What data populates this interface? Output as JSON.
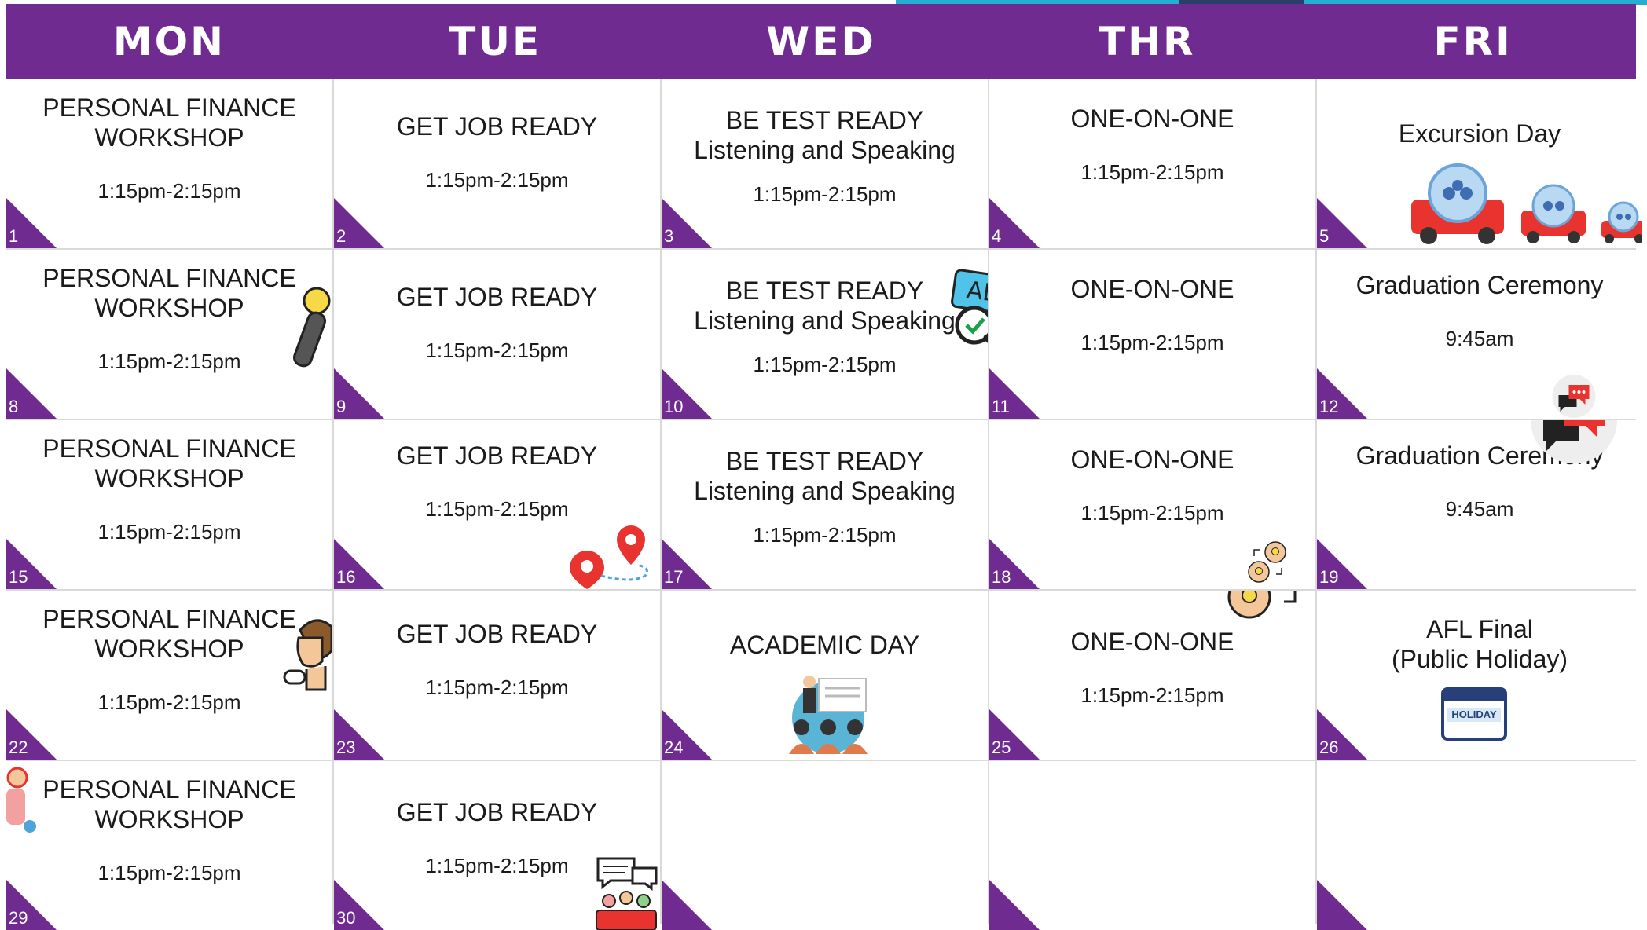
{
  "header": {
    "days": [
      "MON",
      "TUE",
      "WED",
      "THR",
      "FRI"
    ]
  },
  "weeks": [
    {
      "mon": {
        "num": "1",
        "title": "PERSONAL FINANCE WORKSHOP",
        "time": "1:15pm-2:15pm"
      },
      "tue": {
        "num": "2",
        "title": "GET JOB READY",
        "time": "1:15pm-2:15pm"
      },
      "wed": {
        "num": "3",
        "title": "BE TEST READY",
        "subtitle": "Listening and Speaking",
        "time": "1:15pm-2:15pm"
      },
      "thr": {
        "num": "4",
        "title": "ONE-ON-ONE",
        "time": "1:15pm-2:15pm"
      },
      "fri": {
        "num": "5",
        "title": "Excursion Day"
      }
    },
    {
      "mon": {
        "num": "8",
        "title": "PERSONAL FINANCE WORKSHOP",
        "time": "1:15pm-2:15pm"
      },
      "tue": {
        "num": "9",
        "title": "GET JOB READY",
        "time": "1:15pm-2:15pm"
      },
      "wed": {
        "num": "10",
        "title": "BE TEST READY",
        "subtitle": "Listening and Speaking",
        "time": "1:15pm-2:15pm"
      },
      "thr": {
        "num": "11",
        "title": "ONE-ON-ONE",
        "time": "1:15pm-2:15pm"
      },
      "fri": {
        "num": "12",
        "title": "Graduation Ceremony",
        "time": "9:45am"
      }
    },
    {
      "mon": {
        "num": "15",
        "title": "PERSONAL FINANCE WORKSHOP",
        "time": "1:15pm-2:15pm"
      },
      "tue": {
        "num": "16",
        "title": "GET JOB READY",
        "time": "1:15pm-2:15pm"
      },
      "wed": {
        "num": "17",
        "title": "BE TEST READY",
        "subtitle": "Listening and Speaking",
        "time": "1:15pm-2:15pm"
      },
      "thr": {
        "num": "18",
        "title": "ONE-ON-ONE",
        "time": "1:15pm-2:15pm"
      },
      "fri": {
        "num": "19",
        "title": "Graduation Ceremony",
        "time": "9:45am"
      }
    },
    {
      "mon": {
        "num": "22",
        "title": "PERSONAL FINANCE WORKSHOP",
        "time": "1:15pm-2:15pm"
      },
      "tue": {
        "num": "23",
        "title": "GET JOB READY",
        "time": "1:15pm-2:15pm"
      },
      "wed": {
        "num": "24",
        "title": "ACADEMIC DAY"
      },
      "thr": {
        "num": "25",
        "title": "ONE-ON-ONE",
        "time": "1:15pm-2:15pm"
      },
      "fri": {
        "num": "26",
        "title": "AFL Final",
        "subtitle": "(Public Holiday)"
      }
    },
    {
      "mon": {
        "num": "29",
        "title": "PERSONAL FINANCE WORKSHOP",
        "time": "1:15pm-2:15pm"
      },
      "tue": {
        "num": "30",
        "title": "GET JOB READY",
        "time": "1:15pm-2:15pm"
      },
      "wed": {
        "num": ""
      },
      "thr": {
        "num": ""
      },
      "fri": {
        "num": ""
      }
    }
  ],
  "icons": {
    "holiday_badge": "HOLIDAY",
    "quiz_badge": "ABC"
  },
  "colors": {
    "accent": "#702b91",
    "divider": "#d9d9d9"
  }
}
